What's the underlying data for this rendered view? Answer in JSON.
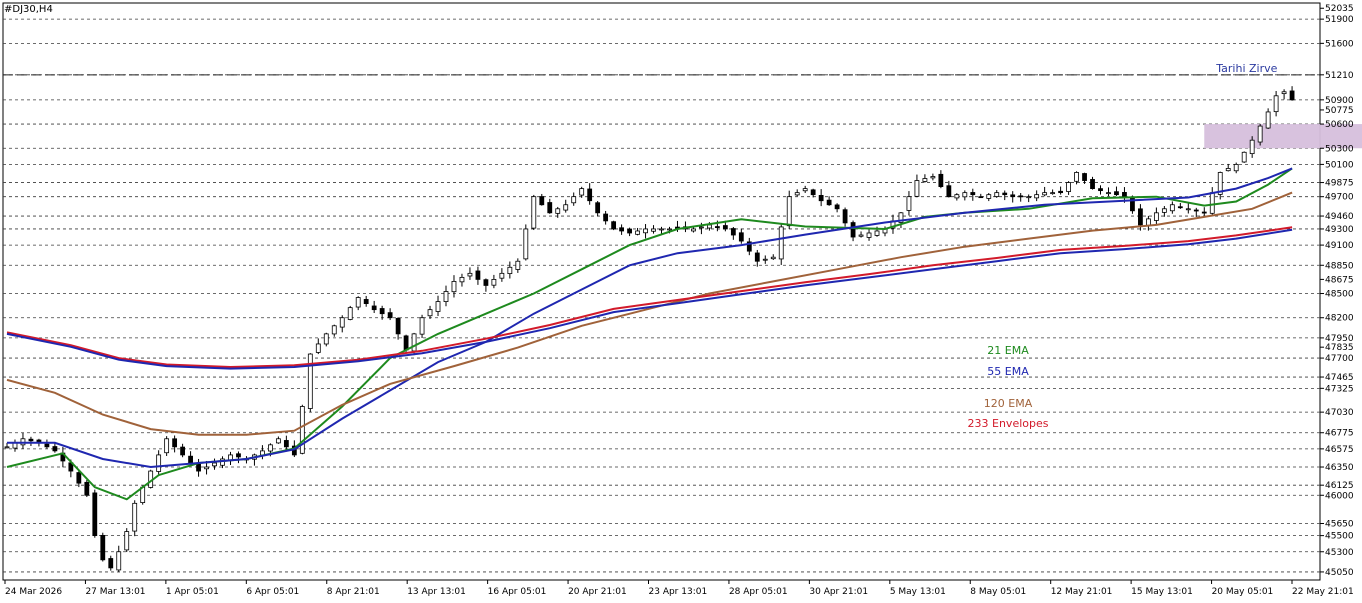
{
  "header": {
    "symbol_label": "#DJ30,H4"
  },
  "colors": {
    "ema21": "#1e8a1e",
    "ema55": "#1f27b0",
    "ema120": "#a0623a",
    "env233_upper": "#d21a2a",
    "env233_lower": "#1f27b0",
    "zone": "#d6bfdc",
    "candle": "#000000",
    "annotation": "#2b3aa0"
  },
  "chart_data": {
    "type": "line",
    "title": "#DJ30,H4",
    "xlabel": "",
    "ylabel": "",
    "ylim": [
      44950,
      52100
    ],
    "grid": true,
    "y_tick_labels": [
      "52035",
      "51900",
      "51600",
      "51210",
      "50900",
      "50775",
      "50600",
      "50300",
      "50100",
      "49875",
      "49700",
      "49460",
      "49300",
      "49100",
      "48850",
      "48675",
      "48500",
      "48200",
      "47950",
      "47835",
      "47700",
      "47465",
      "47325",
      "47030",
      "46775",
      "46575",
      "46350",
      "46125",
      "46000",
      "45650",
      "45500",
      "45300",
      "45050"
    ],
    "dashed_levels": [
      51900,
      51600,
      51210,
      50900,
      50600,
      50300,
      50100,
      49875,
      49700,
      49460,
      49300,
      49100,
      48850,
      48500,
      48200,
      47950,
      47700,
      47465,
      47325,
      47030,
      46775,
      46575,
      46350,
      46125,
      46000,
      45650,
      45500,
      45300,
      45050
    ],
    "x_tick_labels": [
      "24 Mar 2026",
      "27 Mar 13:01",
      "1 Apr 05:01",
      "6 Apr 05:01",
      "8 Apr 21:01",
      "13 Apr 13:01",
      "16 Apr 05:01",
      "20 Apr 21:01",
      "23 Apr 13:01",
      "28 Apr 05:01",
      "30 Apr 21:01",
      "5 May 13:01",
      "8 May 05:01",
      "12 May 21:01",
      "15 May 13:01",
      "20 May 05:01",
      "22 May 21:01"
    ],
    "bar_count": 161,
    "resistance_line": {
      "value": 51210,
      "label": "Tarihi Zirve"
    },
    "zone": {
      "from": 50300,
      "to": 50600,
      "start_bar": 150,
      "end_bar": 170
    },
    "series": [
      {
        "name": "21 EMA",
        "key": "ema21",
        "color": "#1e8a1e",
        "points": [
          [
            0,
            46350
          ],
          [
            7,
            46520
          ],
          [
            11,
            46100
          ],
          [
            15,
            45950
          ],
          [
            19,
            46250
          ],
          [
            24,
            46400
          ],
          [
            30,
            46450
          ],
          [
            36,
            46580
          ],
          [
            42,
            47100
          ],
          [
            48,
            47700
          ],
          [
            54,
            48000
          ],
          [
            60,
            48250
          ],
          [
            66,
            48500
          ],
          [
            72,
            48800
          ],
          [
            78,
            49100
          ],
          [
            84,
            49300
          ],
          [
            92,
            49420
          ],
          [
            100,
            49330
          ],
          [
            110,
            49300
          ],
          [
            115,
            49450
          ],
          [
            120,
            49500
          ],
          [
            128,
            49550
          ],
          [
            136,
            49680
          ],
          [
            144,
            49700
          ],
          [
            150,
            49590
          ],
          [
            154,
            49640
          ],
          [
            158,
            49850
          ],
          [
            161,
            50050
          ]
        ]
      },
      {
        "name": "55 EMA",
        "key": "ema55",
        "color": "#1f27b0",
        "points": [
          [
            0,
            46650
          ],
          [
            6,
            46650
          ],
          [
            12,
            46450
          ],
          [
            18,
            46350
          ],
          [
            24,
            46400
          ],
          [
            30,
            46450
          ],
          [
            36,
            46570
          ],
          [
            42,
            46950
          ],
          [
            48,
            47300
          ],
          [
            54,
            47650
          ],
          [
            60,
            47900
          ],
          [
            66,
            48250
          ],
          [
            72,
            48550
          ],
          [
            78,
            48850
          ],
          [
            84,
            49000
          ],
          [
            92,
            49100
          ],
          [
            100,
            49230
          ],
          [
            110,
            49380
          ],
          [
            120,
            49500
          ],
          [
            130,
            49600
          ],
          [
            140,
            49650
          ],
          [
            148,
            49690
          ],
          [
            154,
            49800
          ],
          [
            158,
            49930
          ],
          [
            161,
            50050
          ]
        ]
      },
      {
        "name": "120 EMA",
        "key": "ema120",
        "color": "#a0623a",
        "points": [
          [
            0,
            47430
          ],
          [
            6,
            47270
          ],
          [
            12,
            47000
          ],
          [
            18,
            46820
          ],
          [
            24,
            46750
          ],
          [
            30,
            46750
          ],
          [
            36,
            46800
          ],
          [
            42,
            47120
          ],
          [
            48,
            47380
          ],
          [
            56,
            47600
          ],
          [
            64,
            47830
          ],
          [
            72,
            48100
          ],
          [
            80,
            48300
          ],
          [
            88,
            48500
          ],
          [
            96,
            48650
          ],
          [
            104,
            48800
          ],
          [
            112,
            48950
          ],
          [
            120,
            49080
          ],
          [
            128,
            49180
          ],
          [
            136,
            49280
          ],
          [
            144,
            49350
          ],
          [
            150,
            49450
          ],
          [
            156,
            49550
          ],
          [
            161,
            49750
          ]
        ]
      },
      {
        "name": "233 Envelopes",
        "key": "env233_upper",
        "color": "#d21a2a",
        "points": [
          [
            0,
            48020
          ],
          [
            8,
            47860
          ],
          [
            14,
            47700
          ],
          [
            20,
            47620
          ],
          [
            28,
            47590
          ],
          [
            36,
            47610
          ],
          [
            44,
            47680
          ],
          [
            52,
            47790
          ],
          [
            60,
            47940
          ],
          [
            68,
            48110
          ],
          [
            76,
            48310
          ],
          [
            84,
            48420
          ],
          [
            92,
            48530
          ],
          [
            100,
            48640
          ],
          [
            108,
            48740
          ],
          [
            116,
            48850
          ],
          [
            124,
            48940
          ],
          [
            132,
            49040
          ],
          [
            140,
            49090
          ],
          [
            148,
            49150
          ],
          [
            154,
            49220
          ],
          [
            161,
            49320
          ]
        ]
      },
      {
        "name": "",
        "key": "env233_lower",
        "color": "#1f27b0",
        "points": [
          [
            0,
            48000
          ],
          [
            8,
            47840
          ],
          [
            14,
            47680
          ],
          [
            20,
            47600
          ],
          [
            28,
            47570
          ],
          [
            36,
            47590
          ],
          [
            44,
            47660
          ],
          [
            52,
            47760
          ],
          [
            60,
            47900
          ],
          [
            68,
            48070
          ],
          [
            76,
            48270
          ],
          [
            84,
            48380
          ],
          [
            92,
            48490
          ],
          [
            100,
            48600
          ],
          [
            108,
            48700
          ],
          [
            116,
            48800
          ],
          [
            124,
            48900
          ],
          [
            132,
            49000
          ],
          [
            140,
            49050
          ],
          [
            148,
            49110
          ],
          [
            154,
            49180
          ],
          [
            161,
            49290
          ]
        ]
      }
    ],
    "price_path": [
      [
        0,
        46600
      ],
      [
        2,
        46700
      ],
      [
        4,
        46650
      ],
      [
        6,
        46550
      ],
      [
        8,
        46300
      ],
      [
        10,
        46000
      ],
      [
        11,
        45500
      ],
      [
        12,
        45200
      ],
      [
        13,
        45100
      ],
      [
        14,
        45300
      ],
      [
        15,
        45550
      ],
      [
        16,
        45900
      ],
      [
        18,
        46300
      ],
      [
        20,
        46700
      ],
      [
        22,
        46500
      ],
      [
        24,
        46300
      ],
      [
        26,
        46400
      ],
      [
        28,
        46500
      ],
      [
        30,
        46450
      ],
      [
        32,
        46550
      ],
      [
        34,
        46700
      ],
      [
        36,
        46500
      ],
      [
        37,
        47100
      ],
      [
        38,
        47750
      ],
      [
        40,
        48000
      ],
      [
        42,
        48200
      ],
      [
        44,
        48450
      ],
      [
        46,
        48300
      ],
      [
        48,
        48200
      ],
      [
        50,
        47800
      ],
      [
        52,
        48200
      ],
      [
        54,
        48400
      ],
      [
        56,
        48650
      ],
      [
        58,
        48750
      ],
      [
        60,
        48600
      ],
      [
        62,
        48750
      ],
      [
        64,
        48900
      ],
      [
        66,
        49700
      ],
      [
        68,
        49500
      ],
      [
        70,
        49600
      ],
      [
        72,
        49800
      ],
      [
        74,
        49500
      ],
      [
        76,
        49300
      ],
      [
        78,
        49250
      ],
      [
        80,
        49300
      ],
      [
        82,
        49300
      ],
      [
        84,
        49300
      ],
      [
        86,
        49300
      ],
      [
        88,
        49350
      ],
      [
        90,
        49300
      ],
      [
        92,
        49150
      ],
      [
        94,
        48900
      ],
      [
        96,
        48950
      ],
      [
        98,
        49700
      ],
      [
        100,
        49800
      ],
      [
        102,
        49650
      ],
      [
        104,
        49550
      ],
      [
        106,
        49200
      ],
      [
        108,
        49250
      ],
      [
        110,
        49300
      ],
      [
        112,
        49500
      ],
      [
        114,
        49900
      ],
      [
        116,
        49950
      ],
      [
        118,
        49700
      ],
      [
        120,
        49750
      ],
      [
        122,
        49700
      ],
      [
        124,
        49750
      ],
      [
        126,
        49700
      ],
      [
        128,
        49700
      ],
      [
        130,
        49750
      ],
      [
        132,
        49750
      ],
      [
        134,
        50000
      ],
      [
        136,
        49800
      ],
      [
        138,
        49750
      ],
      [
        140,
        49700
      ],
      [
        142,
        49350
      ],
      [
        144,
        49500
      ],
      [
        146,
        49600
      ],
      [
        148,
        49550
      ],
      [
        150,
        49500
      ],
      [
        152,
        50000
      ],
      [
        154,
        50100
      ],
      [
        156,
        50400
      ],
      [
        158,
        50750
      ],
      [
        159,
        50950
      ],
      [
        160,
        51000
      ],
      [
        161,
        50900
      ]
    ]
  },
  "legend_labels": {
    "ema21": "21 EMA",
    "ema55": "55 EMA",
    "ema120": "120 EMA",
    "env233": "233 Envelopes"
  }
}
